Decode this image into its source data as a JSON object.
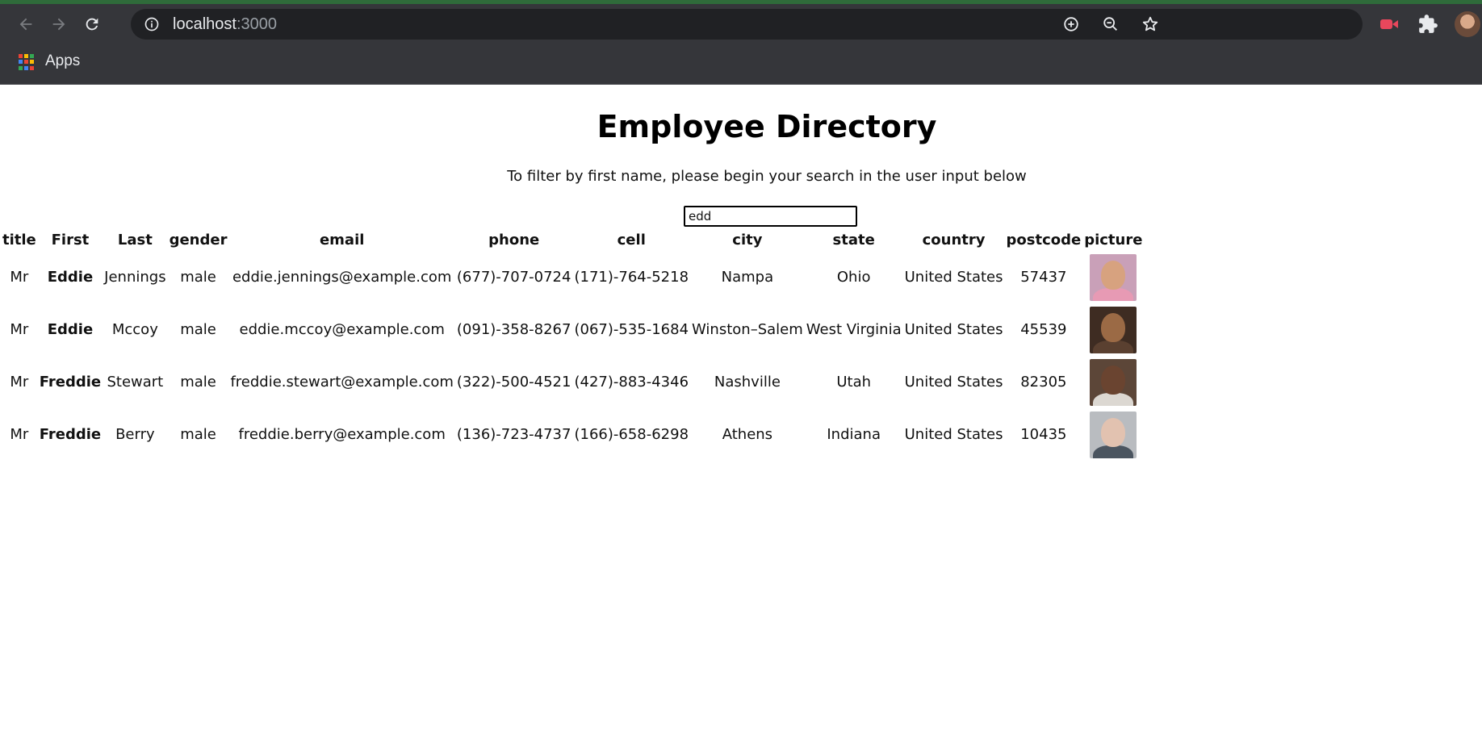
{
  "browser": {
    "url_host": "localhost",
    "url_port": ":3000",
    "bookmarks": {
      "apps_label": "Apps"
    }
  },
  "page": {
    "title": "Employee Directory",
    "subtitle": "To filter by first name, please begin your search in the user input below",
    "search": {
      "value": "edd"
    }
  },
  "table": {
    "headers": [
      "title",
      "First",
      "Last",
      "gender",
      "email",
      "phone",
      "cell",
      "city",
      "state",
      "country",
      "postcode",
      "picture"
    ],
    "rows": [
      {
        "title": "Mr",
        "first": "Eddie",
        "last": "Jennings",
        "gender": "male",
        "email": "eddie.jennings@example.com",
        "phone": "(677)-707-0724",
        "cell": "(171)-764-5218",
        "city": "Nampa",
        "state": "Ohio",
        "country": "United States",
        "postcode": "57437",
        "picture_colors": {
          "bg": "#c9a0b8",
          "face": "#d7a27f",
          "body": "#e79ab4"
        }
      },
      {
        "title": "Mr",
        "first": "Eddie",
        "last": "Mccoy",
        "gender": "male",
        "email": "eddie.mccoy@example.com",
        "phone": "(091)-358-8267",
        "cell": "(067)-535-1684",
        "city": "Winston–Salem",
        "state": "West Virginia",
        "country": "United States",
        "postcode": "45539",
        "picture_colors": {
          "bg": "#3e2c22",
          "face": "#9b6a45",
          "body": "#5a4030"
        }
      },
      {
        "title": "Mr",
        "first": "Freddie",
        "last": "Stewart",
        "gender": "male",
        "email": "freddie.stewart@example.com",
        "phone": "(322)-500-4521",
        "cell": "(427)-883-4346",
        "city": "Nashville",
        "state": "Utah",
        "country": "United States",
        "postcode": "82305",
        "picture_colors": {
          "bg": "#5c4638",
          "face": "#6a4430",
          "body": "#dcd8d2"
        }
      },
      {
        "title": "Mr",
        "first": "Freddie",
        "last": "Berry",
        "gender": "male",
        "email": "freddie.berry@example.com",
        "phone": "(136)-723-4737",
        "cell": "(166)-658-6298",
        "city": "Athens",
        "state": "Indiana",
        "country": "United States",
        "postcode": "10435",
        "picture_colors": {
          "bg": "#b9bcc0",
          "face": "#e2c2b0",
          "body": "#4b5560"
        }
      }
    ]
  }
}
